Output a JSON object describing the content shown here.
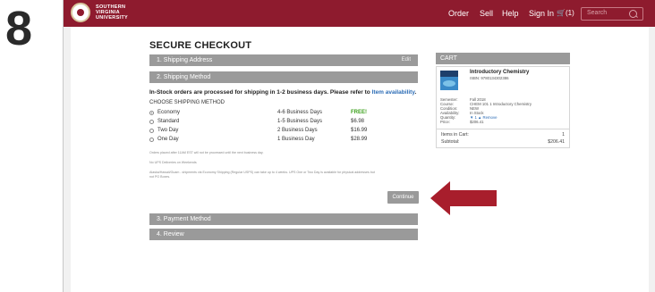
{
  "step_number": "8",
  "header": {
    "logo_lines": [
      "SOUTHERN",
      "VIRGINIA",
      "UNIVERSITY"
    ],
    "nav": {
      "order": "Order",
      "sell": "Sell",
      "help": "Help",
      "sign_in": "Sign In"
    },
    "cart_count": "(1)",
    "search_placeholder": "Search",
    "brand_color": "#8e1b2e"
  },
  "checkout": {
    "title": "SECURE CHECKOUT",
    "steps": {
      "shipping_address": "1. Shipping Address",
      "edit": "Edit",
      "shipping_method": "2. Shipping Method",
      "payment_method": "3. Payment Method",
      "review": "4. Review"
    },
    "processing_text": "In-Stock orders are processed for shipping in 1-2 business days. Please refer to",
    "processing_link": "Item availability",
    "processing_end": ".",
    "choose_label": "CHOOSE SHIPPING METHOD",
    "options": [
      {
        "name": "Economy",
        "time": "4-6 Business Days",
        "price": "FREE!",
        "selected": true
      },
      {
        "name": "Standard",
        "time": "1-5 Business Days",
        "price": "$6.98",
        "selected": false
      },
      {
        "name": "Two Day",
        "time": "2 Business Days",
        "price": "$16.99",
        "selected": false
      },
      {
        "name": "One Day",
        "time": "1 Business Day",
        "price": "$28.99",
        "selected": false
      }
    ],
    "notes": [
      "Orders placed after 11AM EST will not be processed until the next business day.",
      "No UPS Deliveries on Weekends",
      "Alaska/Hawaii/Guam - shipments via Economy Shipping (Regular USPS) can take up to 4 weeks. UPS One or Two Day is available for physical addresses but",
      "not PO Boxes."
    ],
    "continue_label": "Continue"
  },
  "cart": {
    "title": "CART",
    "item": {
      "title": "Introductory Chemistry",
      "isbn": "ISBN: 9780134302386",
      "fields": [
        {
          "label": "Semester:",
          "value": "Fall 2018"
        },
        {
          "label": "Course:",
          "value": "CHEM 101 1 Introductory Chemistry"
        },
        {
          "label": "Condition:",
          "value": "NEW"
        },
        {
          "label": "Availability:",
          "value": "In Stock"
        },
        {
          "label": "Quantity:",
          "value": "▼ 1 ▲ Remove"
        },
        {
          "label": "Price:",
          "value": "$206.41"
        }
      ]
    },
    "items_in_cart_label": "Items in Cart:",
    "items_in_cart_value": "1",
    "subtotal_label": "Subtotal:",
    "subtotal_value": "$206.41"
  },
  "pointer_icon": "arrow-left-icon",
  "pointer_color": "#a81e2c"
}
